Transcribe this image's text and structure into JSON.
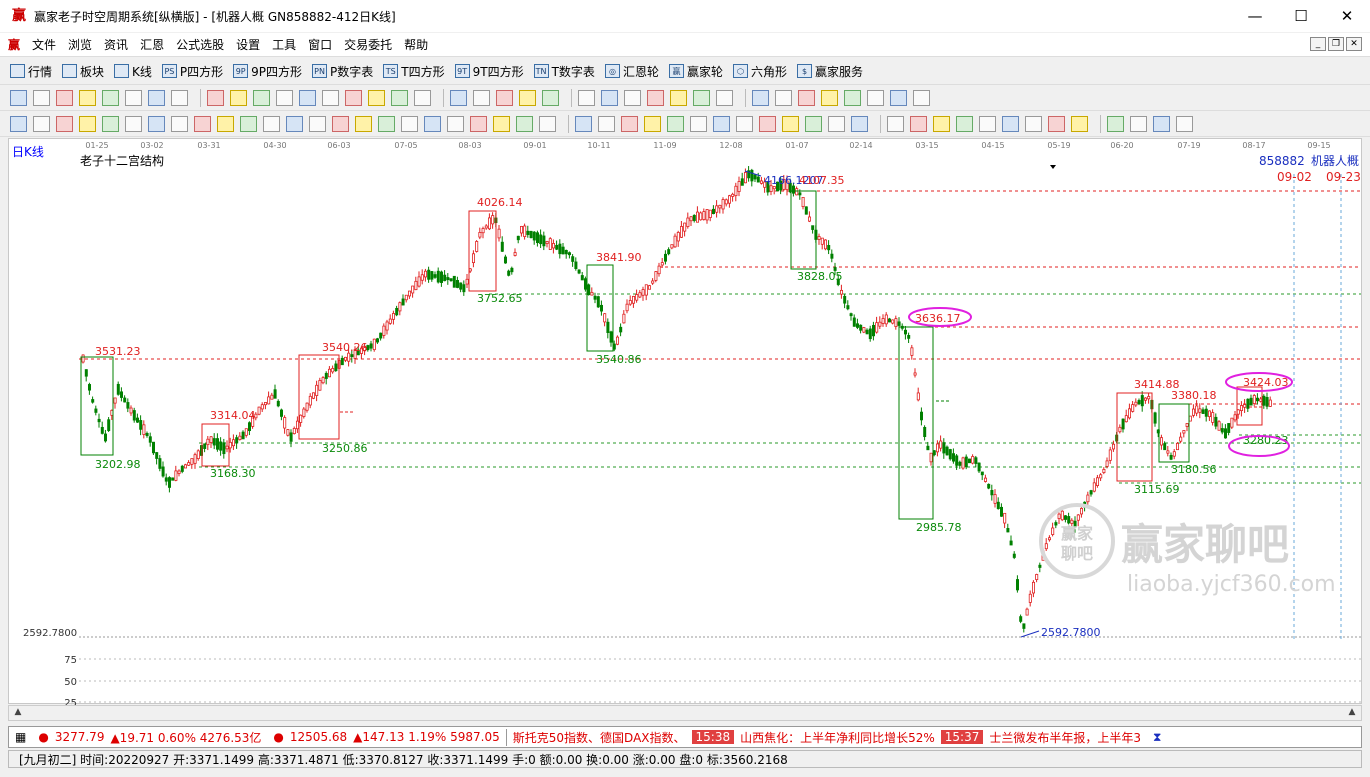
{
  "window": {
    "title": "赢家老子时空周期系统[纵横版] - [机器人概  GN858882-412日K线]",
    "min_label": "—",
    "max_label": "☐",
    "close_label": "✕"
  },
  "menu": [
    "文件",
    "浏览",
    "资讯",
    "汇恩",
    "公式选股",
    "设置",
    "工具",
    "窗口",
    "交易委托",
    "帮助"
  ],
  "toolbar1": [
    {
      "label": "行情",
      "icon": "grid-icon"
    },
    {
      "label": "板块",
      "icon": "blocks-icon"
    },
    {
      "label": "K线",
      "icon": "kline-icon"
    },
    {
      "label": "P四方形",
      "icon": "p-square-icon",
      "ictext": "PS"
    },
    {
      "label": "9P四方形",
      "icon": "9p-square-icon",
      "ictext": "9P"
    },
    {
      "label": "P数字表",
      "icon": "p-number-icon",
      "ictext": "PN"
    },
    {
      "label": "T四方形",
      "icon": "t-square-icon",
      "ictext": "TS"
    },
    {
      "label": "9T四方形",
      "icon": "9t-square-icon",
      "ictext": "9T"
    },
    {
      "label": "T数字表",
      "icon": "t-number-icon",
      "ictext": "TN"
    },
    {
      "label": "汇恩轮",
      "icon": "wheel-icon",
      "ictext": "◎"
    },
    {
      "label": "赢家轮",
      "icon": "winner-wheel-icon",
      "ictext": "赢"
    },
    {
      "label": "六角形",
      "icon": "hexagon-icon",
      "ictext": "⬡"
    },
    {
      "label": "赢家服务",
      "icon": "dollar-icon",
      "ictext": "$"
    }
  ],
  "chart_header": {
    "period": "日K线",
    "indicator_title": "老子十二宫结构",
    "code": "858882",
    "name": "机器人概",
    "date_right1": "09-02",
    "date_right2": "09-23"
  },
  "date_ticks": [
    "01-25",
    "03-02",
    "03-31",
    "04-30",
    "06-03",
    "07-05",
    "08-03",
    "09-01",
    "10-11",
    "11-09",
    "12-08",
    "01-07",
    "02-14",
    "03-15",
    "04-15",
    "05-19",
    "06-20",
    "07-19",
    "08-17",
    "09-15"
  ],
  "price_annotations": [
    {
      "text": "3531.23",
      "color": "red"
    },
    {
      "text": "3202.98",
      "color": "green"
    },
    {
      "text": "3314.04",
      "color": "red"
    },
    {
      "text": "3168.30",
      "color": "green"
    },
    {
      "text": "3540.26",
      "color": "red"
    },
    {
      "text": "3250.86",
      "color": "green"
    },
    {
      "text": "4026.14",
      "color": "red"
    },
    {
      "text": "3752.65",
      "color": "green"
    },
    {
      "text": "3841.90",
      "color": "red"
    },
    {
      "text": "3540.86",
      "color": "green"
    },
    {
      "text": "4166.1207",
      "color": "blue"
    },
    {
      "text": "4107.35",
      "color": "red"
    },
    {
      "text": "3828.05",
      "color": "green"
    },
    {
      "text": "3636.17",
      "color": "red"
    },
    {
      "text": "2985.78",
      "color": "green"
    },
    {
      "text": "2592.7800",
      "color": "blue"
    },
    {
      "text": "3414.88",
      "color": "red"
    },
    {
      "text": "3380.18",
      "color": "red"
    },
    {
      "text": "3180.56",
      "color": "green"
    },
    {
      "text": "3115.69",
      "color": "green"
    },
    {
      "text": "3424.03",
      "color": "red"
    },
    {
      "text": "3280.23",
      "color": "green"
    }
  ],
  "low_label": "2592.7800",
  "indicator_axis": [
    "75",
    "50",
    "25"
  ],
  "watermark": {
    "cn": "赢家聊吧",
    "url": "liaoba.yjcf360.com",
    "seal_top": "赢家",
    "seal_bottom": "聊吧"
  },
  "statusbar": {
    "index1_value": "3277.79",
    "index1_change": "▲19.71 0.60% 4276.53亿",
    "index2_value": "12505.68",
    "index2_change": "▲147.13 1.19% 5987.05",
    "ticker_text1": "斯托克50指数、德国DAX指数、",
    "time1": "15:38",
    "news1": "山西焦化：上半年净利同比增长52%",
    "time2": "15:37",
    "news2": "士兰微发布半年报，上半年3"
  },
  "infobar": "[九月初二] 时间:20220927 开:3371.1499 高:3371.4871 低:3370.8127 收:3371.1499 手:0 额:0.00 换:0.00 涨:0.00 盘:0 标:3560.2168",
  "colors": {
    "up": "#e02020",
    "down": "#008000",
    "dashed_red": "#e02020",
    "dashed_green": "#2a9a2a",
    "circle": "#e020e0",
    "blue": "#1a2fbf"
  }
}
